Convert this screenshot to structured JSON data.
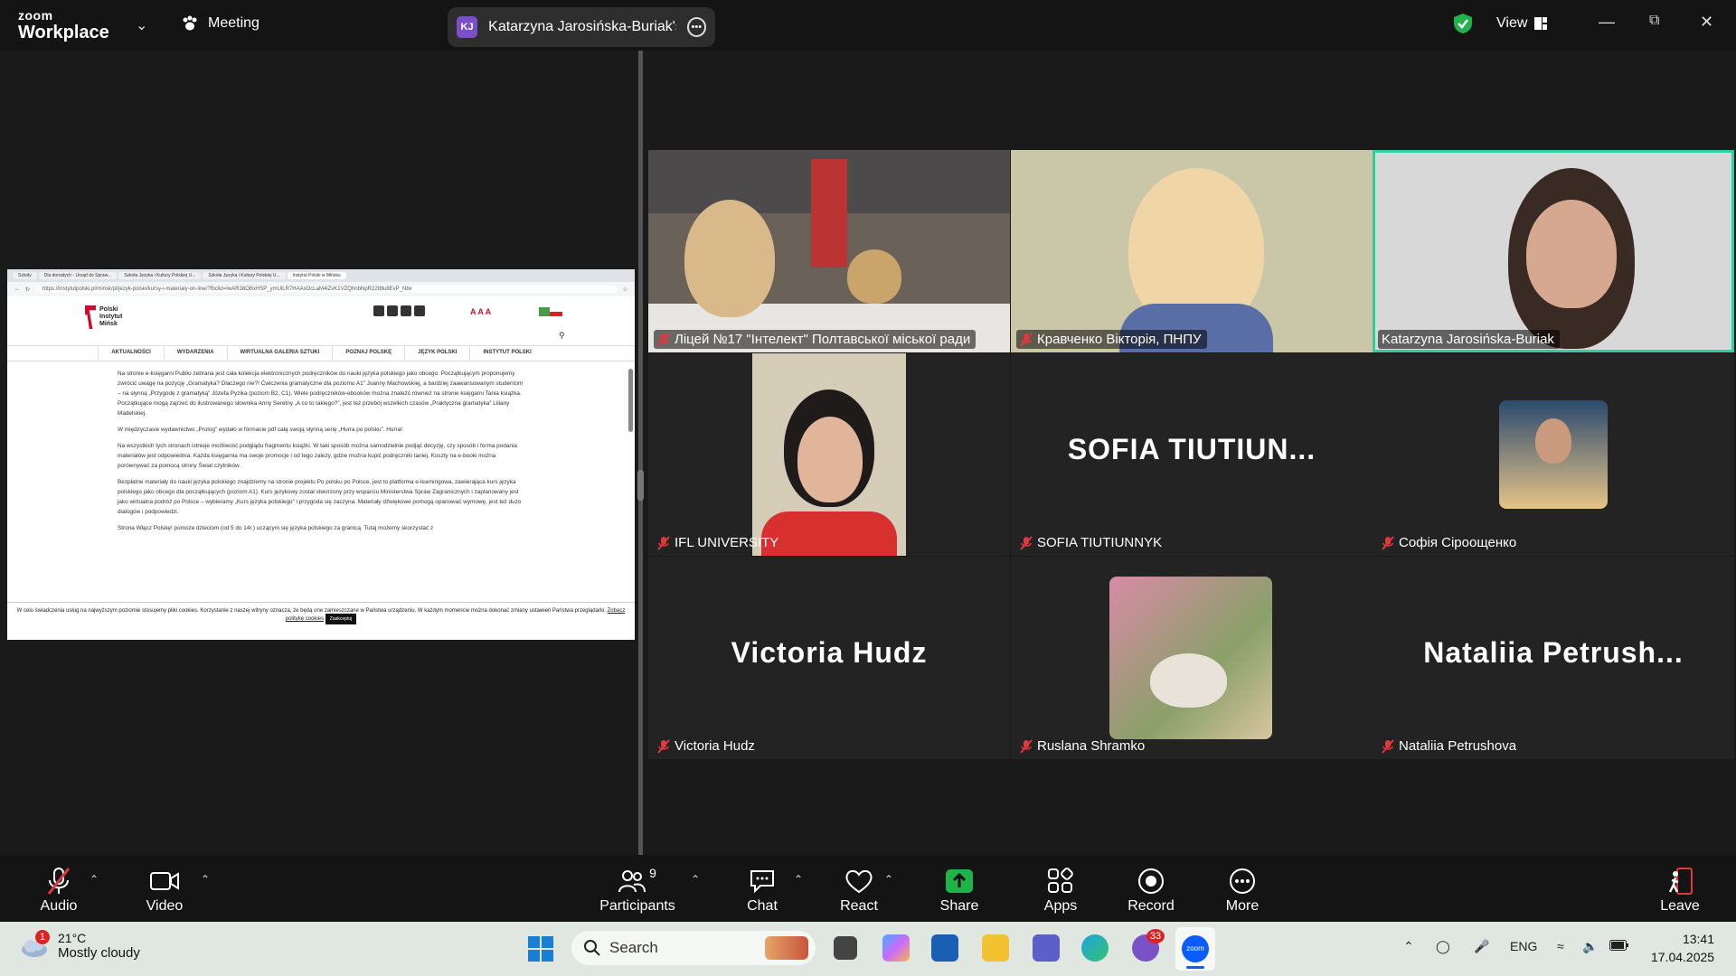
{
  "app": {
    "brand_top": "zoom",
    "brand_bottom": "Workplace",
    "meeting_label": "Meeting",
    "share_initials": "KJ",
    "share_title": "Katarzyna Jarosińska-Buriak's scre",
    "view_label": "View"
  },
  "browser": {
    "tabs": [
      "Szkoły",
      "Dla dorosłych - Urząd do Spraw...",
      "Szkoła Języka i Kultury Polskiej U...",
      "Szkoła Języka i Kultury Polskiej U...",
      "Instytut Polski w Mińsku"
    ],
    "url": "https://instytutpolski.pl/minsk/pl/jezyk-polski/kursy-i-materialy-on-line/?fbclid=IwAR38OBxHSP_ymUlLR7HAAxOcLaM4iZvK1VZQhnbNpR22t8lu8EvP_Nbv",
    "logo_lines": [
      "Polski",
      "Instytut",
      "Mińsk"
    ],
    "aaa": "A A A",
    "nav": [
      "AKTUALNOŚCI",
      "WYDARZENIA",
      "WIRTUALNA GALERIA SZTUKI",
      "POZNAJ POLSKĘ",
      "JĘZYK POLSKI",
      "INSTYTUT POLSKI"
    ],
    "paragraphs": [
      "Na stronie e-księgarni Publio zebrana jest cała kolekcja elektronicznych podręczników do nauki języka polskiego jako obcego. Początkującym proponujemy zwrócić uwagę na pozycję „Gramatyka? Dlaczego nie?! Ćwiczenia gramatyczne dla poziomu A1” Joanny Machowskiej, a bardziej zaawansowanym studentom – na słynną „Przygodę z gramatyką” Józefa Pyzika (poziom B2, C1). Wiele podręczników-ebooków można znaleźć również na stronie księgarni Tania książka. Początkujące mogą zajrzeć do ilustrowanego słownika Anny Seretny „A co to takiego?”, jest też przebój wszelkich czasów „Praktyczna gramatyka” Liliany Madelskiej.",
      "W międzyczasie wydawnictwo „Prolog” wydało w formacie pdf całą swoją słynną serię „Hurra po polsku”. Hurra!",
      "Na wszystkich tych stronach istnieje możliwość podglądu fragmentu książki. W taki sposób można samodzielnie podjąć decyzję, czy sposób i forma podania materiałów jest odpowiednia. Każda księgarnia ma swoje promocje i od tego zależy, gdzie można kupić podręczniki taniej. Koszty na e-booki można porównywać za pomocą strony Świat czytników.",
      "Bezpłatne materiały do nauki języka polskiego znajdziemy na stronie projektu Po polsku po Polsce, jest to platforma e-learningowa, zawierająca kurs języka polskiego jako obcego dla początkujących (poziom A1). Kurs językowy został stworzony przy wsparciu Ministerstwa Spraw Zagranicznych i zaplanowany jest jako wirtualna podróż po Polsce – wybieramy „Kurs języka polskiego” i przygoda się zaczyna. Materiały dźwiękowe pomogą opanować wymowę, jest też dużo dialogów i podpowiedzi.",
      "Strona Włącz Polskę! pomoże dzieciom (od 5 do 14r.) uczącym się języka polskiego za granicą. Tutaj możemy skorzystać z"
    ],
    "cookie_text": "W celu świadczenia usług na najwyższym poziomie stosujemy pliki cookies. Korzystanie z naszej witryny oznacza, że będą one zamieszczane w Państwa urządzeniu. W każdym momencie można dokonać zmiany ustawień Państwa przeglądarki.",
    "cookie_link": "Zobacz politykę cookies",
    "cookie_button": "Zaakceptuj"
  },
  "participants": [
    {
      "name": "Ліцей №17 \"Інтелект\" Полтавської міської ради",
      "muted": true
    },
    {
      "name": "Кравченко Вікторія, ПНПУ",
      "muted": true
    },
    {
      "name": "Katarzyna Jarosińska-Buriak",
      "muted": false,
      "active_speaker": true
    },
    {
      "name": "IFL UNIVERSITY",
      "muted": true
    },
    {
      "name": "SOFIA TIUTIUNNYK",
      "display": "SOFIA  TIUTIUN...",
      "muted": true
    },
    {
      "name": "Софія Сіроощенко",
      "muted": true
    },
    {
      "name": "Victoria Hudz",
      "display": "Victoria Hudz",
      "muted": true
    },
    {
      "name": "Ruslana Shramko",
      "muted": true
    },
    {
      "name": "Nataliia Petrushova",
      "display": "Nataliia  Petrush...",
      "muted": true
    }
  ],
  "toolbar": {
    "audio": "Audio",
    "video": "Video",
    "participants": "Participants",
    "participants_count": "9",
    "chat": "Chat",
    "react": "React",
    "share": "Share",
    "apps": "Apps",
    "record": "Record",
    "more": "More",
    "leave": "Leave"
  },
  "taskbar": {
    "weather_badge": "1",
    "temperature": "21°C",
    "condition": "Mostly cloudy",
    "search_placeholder": "Search",
    "viber_badge": "33",
    "language": "ENG",
    "time": "13:41",
    "date": "17.04.2025"
  },
  "colors": {
    "active_speaker": "#2dd0a0",
    "share_green": "#1fb44a",
    "muted_red": "#e0383e",
    "shield_green": "#22b14c",
    "zoom_blue": "#0b5cff"
  }
}
